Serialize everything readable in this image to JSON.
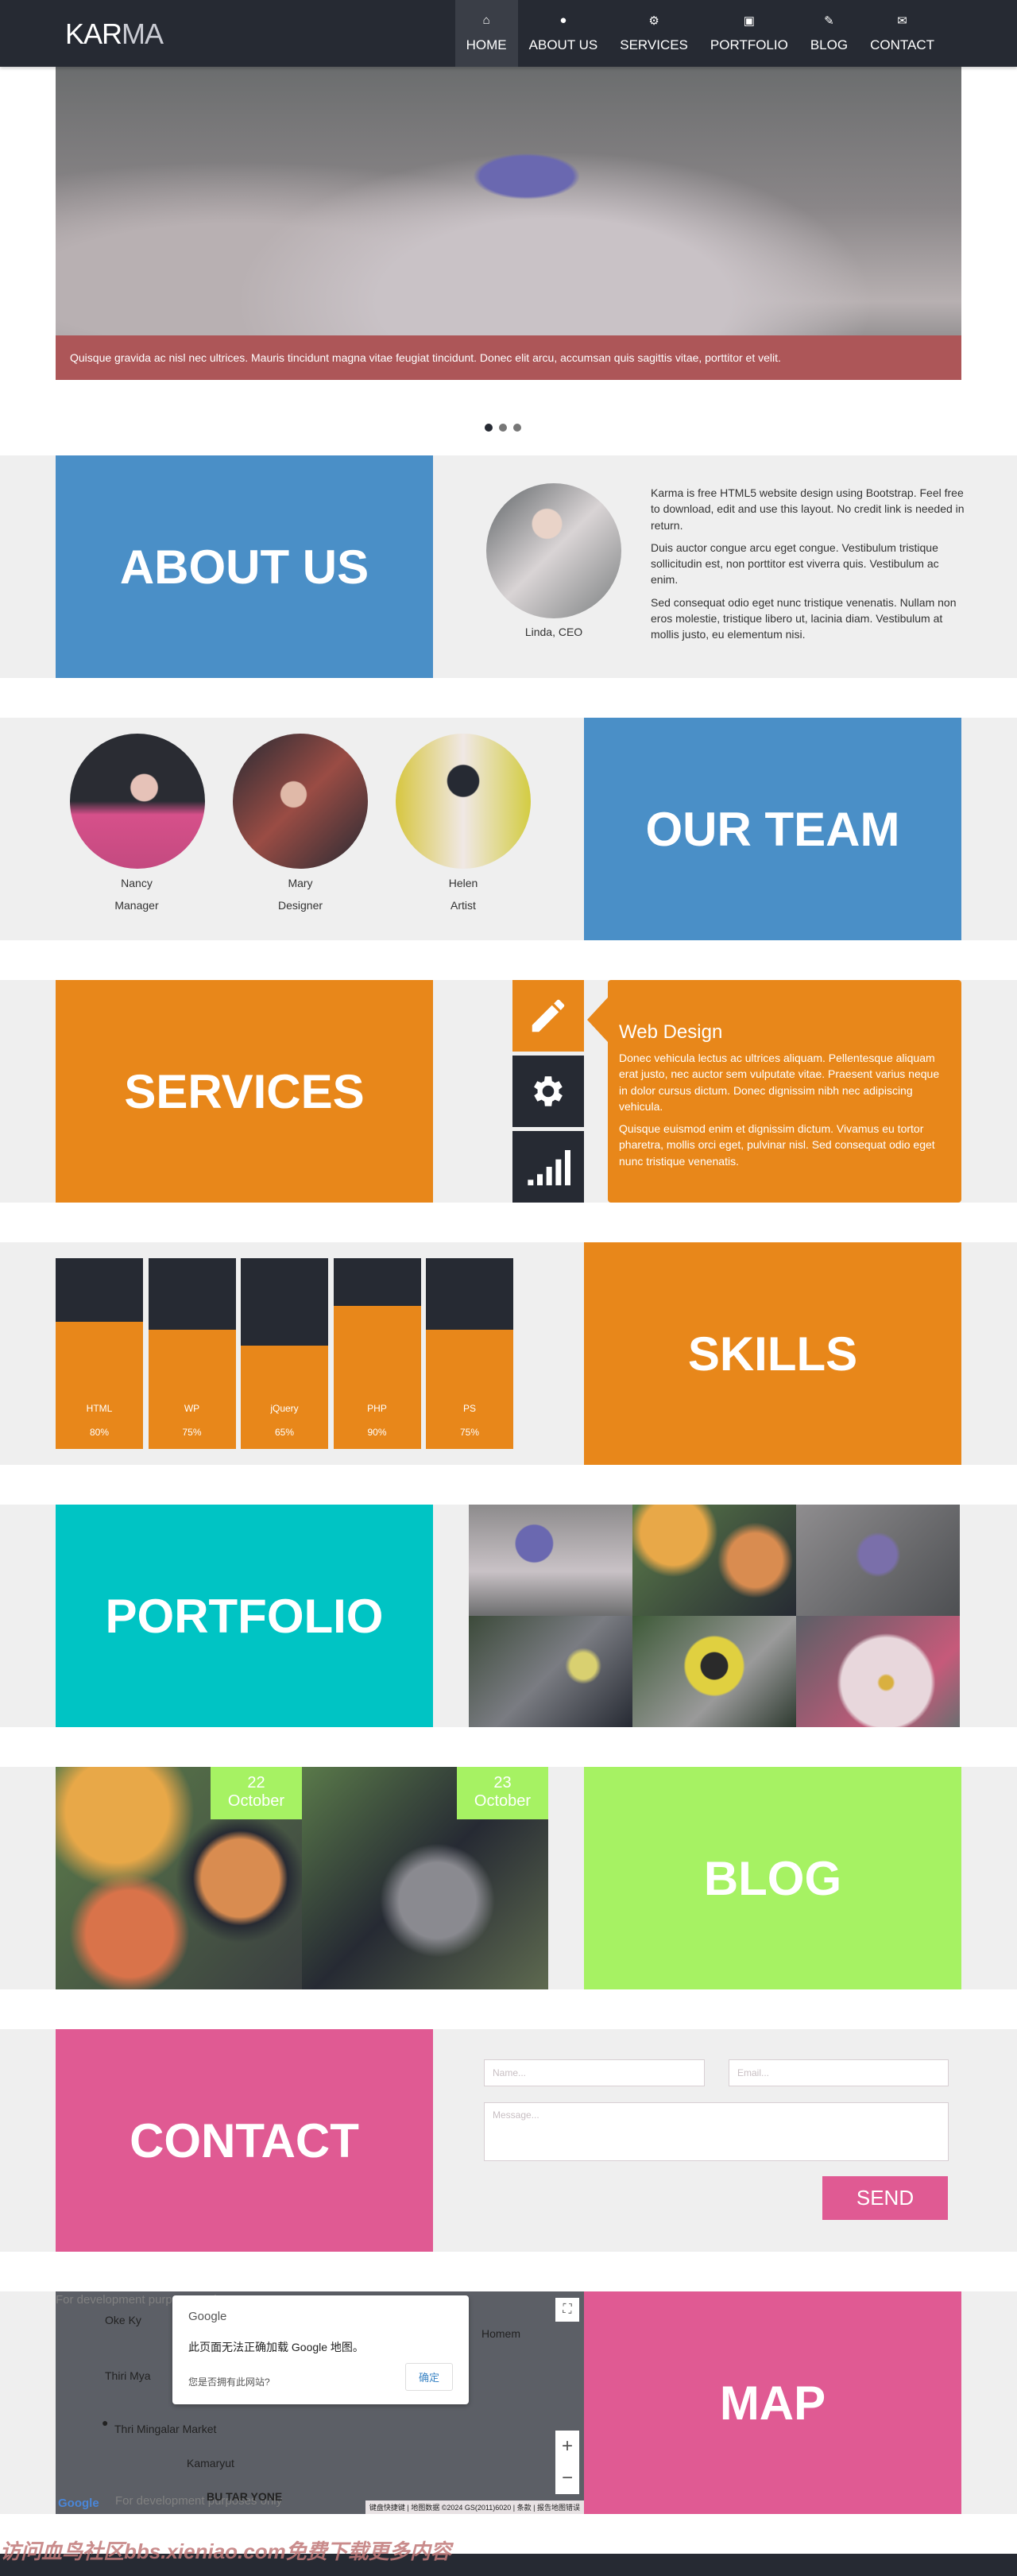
{
  "header": {
    "logo_dark": "KAR",
    "logo_light": "MA",
    "nav": [
      {
        "label": "HOME",
        "icon": "home-icon",
        "glyph": "⌂",
        "active": true
      },
      {
        "label": "ABOUT US",
        "icon": "user-icon",
        "glyph": "●"
      },
      {
        "label": "SERVICES",
        "icon": "cogs-icon",
        "glyph": "⚙"
      },
      {
        "label": "PORTFOLIO",
        "icon": "briefcase-icon",
        "glyph": "▣"
      },
      {
        "label": "BLOG",
        "icon": "pencil-icon",
        "glyph": "✎"
      },
      {
        "label": "CONTACT",
        "icon": "envelope-icon",
        "glyph": "✉"
      }
    ]
  },
  "slider": {
    "caption": "Quisque gravida ac nisl nec ultrices. Mauris tincidunt magna vitae feugiat tincidunt. Donec elit arcu, accumsan quis sagittis vitae, porttitor et velit.",
    "slides": 3,
    "active": 0
  },
  "about": {
    "title": "ABOUT US",
    "person": "Linda, CEO",
    "paragraphs": [
      "Karma is free HTML5 website design using Bootstrap. Feel free to download, edit and use this layout. No credit link is needed in return.",
      "Duis auctor congue arcu eget congue. Vestibulum tristique sollicitudin est, non porttitor est viverra quis. Vestibulum ac enim.",
      "Sed consequat odio eget nunc tristique venenatis. Nullam non eros molestie, tristique libero ut, lacinia diam. Vestibulum at mollis justo, eu elementum nisi."
    ]
  },
  "team": {
    "title": "OUR TEAM",
    "members": [
      {
        "name": "Nancy",
        "role": "Manager"
      },
      {
        "name": "Mary",
        "role": "Designer"
      },
      {
        "name": "Helen",
        "role": "Artist"
      }
    ]
  },
  "services": {
    "title": "SERVICES",
    "heading": "Web Design",
    "paragraphs": [
      "Donec vehicula lectus ac ultrices aliquam. Pellentesque aliquam erat justo, nec auctor sem vulputate vitae. Praesent varius neque in dolor cursus dictum. Donec dignissim nibh nec adipiscing vehicula.",
      "Quisque euismod enim et dignissim dictum. Vivamus eu tortor pharetra, mollis orci eget, pulvinar nisl. Sed consequat odio eget nunc tristique venenatis."
    ]
  },
  "skills": {
    "title": "SKILLS",
    "items": [
      {
        "name": "HTML",
        "value": 80,
        "label": "80%"
      },
      {
        "name": "WP",
        "value": 75,
        "label": "75%"
      },
      {
        "name": "jQuery",
        "value": 65,
        "label": "65%"
      },
      {
        "name": "PHP",
        "value": 90,
        "label": "90%"
      },
      {
        "name": "PS",
        "value": 75,
        "label": "75%"
      }
    ]
  },
  "portfolio": {
    "title": "PORTFOLIO"
  },
  "blog": {
    "title": "BLOG",
    "posts": [
      {
        "day": "22",
        "month": "October"
      },
      {
        "day": "23",
        "month": "October"
      }
    ]
  },
  "contact": {
    "title": "CONTACT",
    "name_placeholder": "Name...",
    "email_placeholder": "Email...",
    "message_placeholder": "Message...",
    "send_label": "SEND"
  },
  "map": {
    "title": "MAP",
    "dialog_brand": "Google",
    "dialog_message": "此页面无法正确加载 Google 地图。",
    "dialog_question": "您是否拥有此网站?",
    "dialog_ok": "确定",
    "labels": [
      "Thri Mingalar Market",
      "Kamaryut",
      "BU TAR YONE",
      "Oke Ky",
      "Thiri Mya",
      "Homem"
    ],
    "watermark": "For development purposes only",
    "attribution": [
      "键盘快捷键",
      "地图数据 ©2024 GS(2011)6020",
      "条款",
      "报告地图错误"
    ]
  },
  "watermark": "访问血鸟社区bbs.xieniao.com免费下载更多内容",
  "colors": {
    "dark": "#262a33",
    "blue": "#4a8fc7",
    "orange": "#e8871a",
    "cyan": "#00c4c4",
    "green": "#a6f263",
    "pink": "#e05a93",
    "caption": "#ad5658"
  }
}
